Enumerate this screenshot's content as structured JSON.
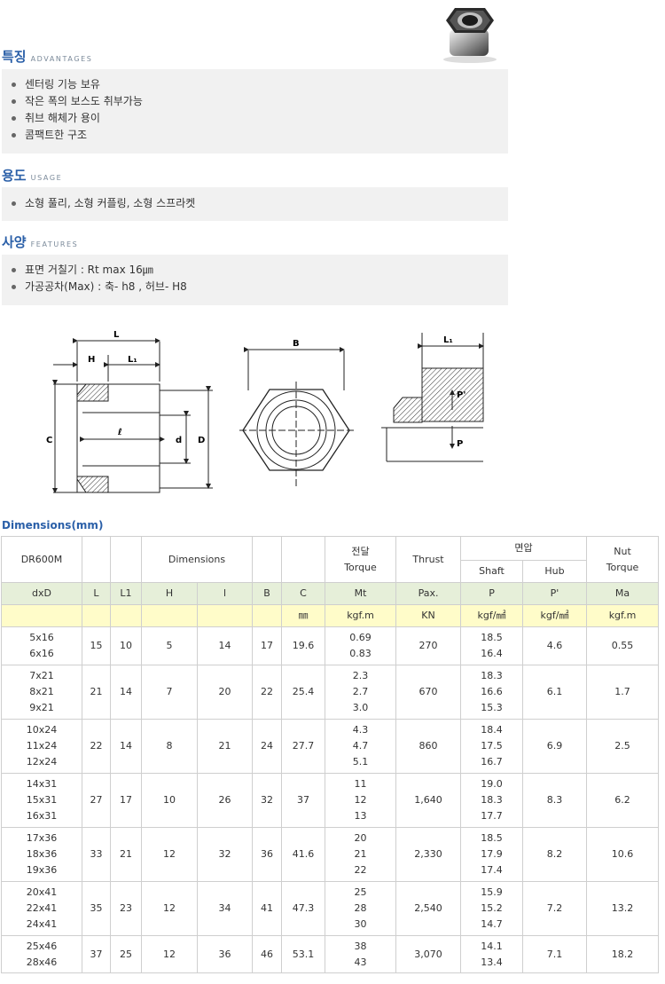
{
  "sections": {
    "advantages": {
      "title_ko": "특징",
      "title_en": "ADVANTAGES",
      "items": [
        "센터링 기능 보유",
        "작은 폭의 보스도 취부가능",
        "취브 해체가 용이",
        "콤팩트한 구조"
      ]
    },
    "usage": {
      "title_ko": "용도",
      "title_en": "USAGE",
      "items": [
        "소형 풀리, 소형 커플링, 소형 스프라켓"
      ]
    },
    "features": {
      "title_ko": "사양",
      "title_en": "FEATURES",
      "items": [
        "표면 거칠기 : Rt max 16㎛",
        "가공공차(Max) : 축- h8 , 허브- H8"
      ]
    }
  },
  "diagram": {
    "labels": {
      "L": "L",
      "H": "H",
      "L1": "L₁",
      "l": "ℓ",
      "d": "d",
      "D": "D",
      "C": "C",
      "B": "B",
      "L1b": "L₁",
      "Pp": "P'",
      "P": "P"
    }
  },
  "table": {
    "title": "Dimensions(mm)",
    "header": {
      "model": "DR600M",
      "dimensions": "Dimensions",
      "torque_ko": "전달",
      "torque_en": "Torque",
      "thrust": "Thrust",
      "pressure_ko": "면압",
      "shaft": "Shaft",
      "hub": "Hub",
      "nut_torque_1": "Nut",
      "nut_torque_2": "Torque"
    },
    "symbols": [
      "dxD",
      "L",
      "L1",
      "H",
      "l",
      "B",
      "C",
      "Mt",
      "Pax.",
      "P",
      "P'",
      "Ma"
    ],
    "units": [
      "",
      "",
      "",
      "",
      "",
      "",
      "㎜",
      "kgf.m",
      "KN",
      "kgf/㎟",
      "kgf/㎟",
      "kgf.m"
    ],
    "rows": [
      {
        "dxD": [
          "5x16",
          "6x16"
        ],
        "L": "15",
        "L1": "10",
        "H": "5",
        "l": "14",
        "B": "17",
        "C": "19.6",
        "Mt": [
          "0.69",
          "0.83"
        ],
        "Pax": "270",
        "P": [
          "18.5",
          "16.4"
        ],
        "Pp": "4.6",
        "Ma": "0.55"
      },
      {
        "dxD": [
          "7x21",
          "8x21",
          "9x21"
        ],
        "L": "21",
        "L1": "14",
        "H": "7",
        "l": "20",
        "B": "22",
        "C": "25.4",
        "Mt": [
          "2.3",
          "2.7",
          "3.0"
        ],
        "Pax": "670",
        "P": [
          "18.3",
          "16.6",
          "15.3"
        ],
        "Pp": "6.1",
        "Ma": "1.7"
      },
      {
        "dxD": [
          "10x24",
          "11x24",
          "12x24"
        ],
        "L": "22",
        "L1": "14",
        "H": "8",
        "l": "21",
        "B": "24",
        "C": "27.7",
        "Mt": [
          "4.3",
          "4.7",
          "5.1"
        ],
        "Pax": "860",
        "P": [
          "18.4",
          "17.5",
          "16.7"
        ],
        "Pp": "6.9",
        "Ma": "2.5"
      },
      {
        "dxD": [
          "14x31",
          "15x31",
          "16x31"
        ],
        "L": "27",
        "L1": "17",
        "H": "10",
        "l": "26",
        "B": "32",
        "C": "37",
        "Mt": [
          "11",
          "12",
          "13"
        ],
        "Pax": "1,640",
        "P": [
          "19.0",
          "18.3",
          "17.7"
        ],
        "Pp": "8.3",
        "Ma": "6.2"
      },
      {
        "dxD": [
          "17x36",
          "18x36",
          "19x36"
        ],
        "L": "33",
        "L1": "21",
        "H": "12",
        "l": "32",
        "B": "36",
        "C": "41.6",
        "Mt": [
          "20",
          "21",
          "22"
        ],
        "Pax": "2,330",
        "P": [
          "18.5",
          "17.9",
          "17.4"
        ],
        "Pp": "8.2",
        "Ma": "10.6"
      },
      {
        "dxD": [
          "20x41",
          "22x41",
          "24x41"
        ],
        "L": "35",
        "L1": "23",
        "H": "12",
        "l": "34",
        "B": "41",
        "C": "47.3",
        "Mt": [
          "25",
          "28",
          "30"
        ],
        "Pax": "2,540",
        "P": [
          "15.9",
          "15.2",
          "14.7"
        ],
        "Pp": "7.2",
        "Ma": "13.2"
      },
      {
        "dxD": [
          "25x46",
          "28x46"
        ],
        "L": "37",
        "L1": "25",
        "H": "12",
        "l": "36",
        "B": "46",
        "C": "53.1",
        "Mt": [
          "38",
          "43"
        ],
        "Pax": "3,070",
        "P": [
          "14.1",
          "13.4"
        ],
        "Pp": "7.1",
        "Ma": "18.2"
      }
    ]
  }
}
